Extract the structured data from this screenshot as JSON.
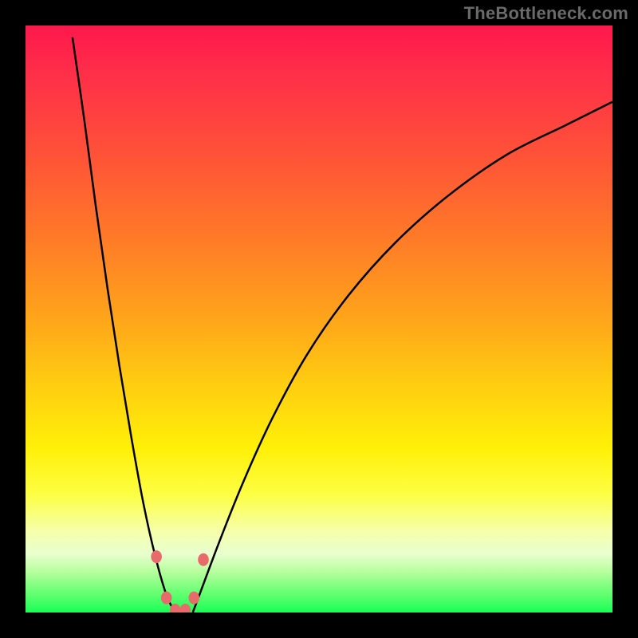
{
  "watermark": "TheBottleneck.com",
  "chart_data": {
    "type": "line",
    "title": "",
    "xlabel": "",
    "ylabel": "",
    "xlim": [
      0,
      100
    ],
    "ylim": [
      0,
      100
    ],
    "series": [
      {
        "name": "left-branch",
        "x": [
          8,
          10,
          12,
          14,
          16,
          18,
          20,
          22,
          24,
          25.5
        ],
        "values": [
          98,
          84,
          69,
          55,
          42,
          30,
          19,
          10,
          3,
          0
        ]
      },
      {
        "name": "right-branch",
        "x": [
          28.5,
          30,
          33,
          37,
          42,
          48,
          55,
          63,
          72,
          82,
          92,
          100
        ],
        "values": [
          0,
          4,
          12,
          22,
          33,
          44,
          54,
          63,
          71,
          78,
          83,
          87
        ]
      }
    ],
    "markers": {
      "name": "beads",
      "points": [
        {
          "x": 22.3,
          "y": 9.5
        },
        {
          "x": 24.0,
          "y": 2.5
        },
        {
          "x": 25.5,
          "y": 0.4
        },
        {
          "x": 27.2,
          "y": 0.4
        },
        {
          "x": 28.7,
          "y": 2.5
        },
        {
          "x": 30.3,
          "y": 9.0
        }
      ],
      "radius_px": 8
    },
    "gradient_stops": [
      {
        "pos": 0.0,
        "color": "#ff184c"
      },
      {
        "pos": 0.5,
        "color": "#ffa51a"
      },
      {
        "pos": 0.8,
        "color": "#fdff44"
      },
      {
        "pos": 1.0,
        "color": "#19ff57"
      }
    ]
  }
}
